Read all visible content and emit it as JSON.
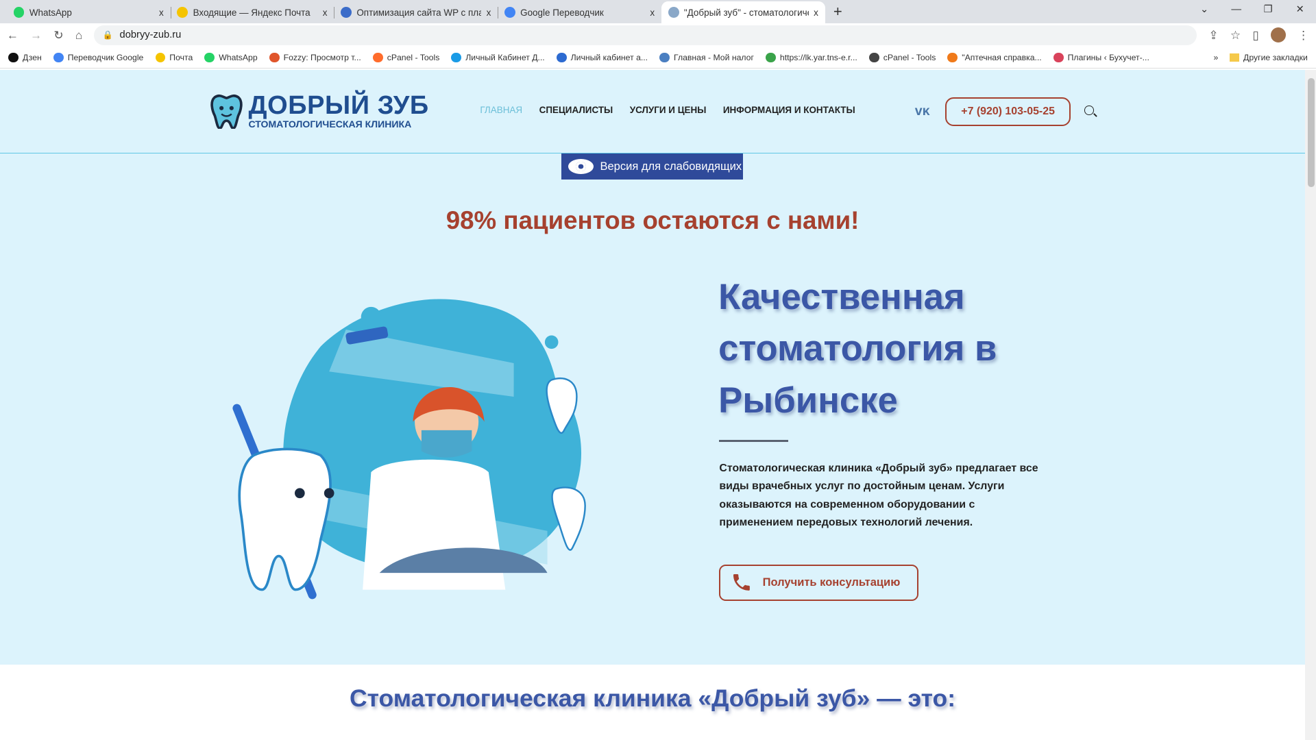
{
  "browser": {
    "tabs": [
      {
        "label": "WhatsApp",
        "color": "#25d366"
      },
      {
        "label": "Входящие — Яндекс Почта",
        "color": "#f5c400"
      },
      {
        "label": "Оптимизация сайта WP с плаги",
        "color": "#3b6cc9"
      },
      {
        "label": "Google Переводчик",
        "color": "#4285f4"
      },
      {
        "label": "\"Добрый зуб\" - стоматологичес",
        "color": "#8aa8c8"
      }
    ],
    "close": "x",
    "new_tab": "+",
    "url": "dobryy-zub.ru",
    "bookmarks": [
      {
        "label": "Дзен",
        "color": "#111"
      },
      {
        "label": "Переводчик Google",
        "color": "#4285f4"
      },
      {
        "label": "Почта",
        "color": "#f5c400"
      },
      {
        "label": "WhatsApp",
        "color": "#25d366"
      },
      {
        "label": "Fozzy: Просмотр т...",
        "color": "#e0552b"
      },
      {
        "label": "cPanel - Tools",
        "color": "#ff6c2c"
      },
      {
        "label": "Личный Кабинет Д...",
        "color": "#1a9be6"
      },
      {
        "label": "Личный кабинет а...",
        "color": "#2d6bd1"
      },
      {
        "label": "Главная - Мой налог",
        "color": "#4b7fc1"
      },
      {
        "label": "https://lk.yar.tns-e.r...",
        "color": "#3aa34a"
      },
      {
        "label": "cPanel - Tools",
        "color": "#444"
      },
      {
        "label": "\"Аптечная справка...",
        "color": "#f07a1a"
      },
      {
        "label": "Плагины ‹ Бухучет-...",
        "color": "#d9435b"
      }
    ],
    "more": "»",
    "other_bookmarks": "Другие закладки"
  },
  "site": {
    "logo_title": "ДОБРЫЙ ЗУБ",
    "logo_subtitle": "СТОМАТОЛОГИЧЕСКАЯ КЛИНИКА",
    "nav": [
      "ГЛАВНАЯ",
      "СПЕЦИАЛИСТЫ",
      "УСЛУГИ И ЦЕНЫ",
      "ИНФОРМАЦИЯ И КОНТАКТЫ"
    ],
    "vk": "vk",
    "phone": "+7 (920) 103-05-25",
    "accessibility": "Версия для слабовидящих",
    "promo": "98% пациентов остаются с нами!",
    "hero_lines": [
      "Качественная",
      "стоматология в",
      "Рыбинске"
    ],
    "description": "Стоматологическая клиника «Добрый зуб» предлагает все виды врачебных услуг по достойным ценам. Услуги оказываются на современном оборудовании с применением передовых технологий лечения.",
    "cta": "Получить консультацию",
    "section_title": "Стоматологическая клиника «Добрый зуб» — это:",
    "colors": {
      "bg": "#dcf3fc",
      "accent_blue": "#3b57a6",
      "accent_red": "#a6412f"
    }
  }
}
